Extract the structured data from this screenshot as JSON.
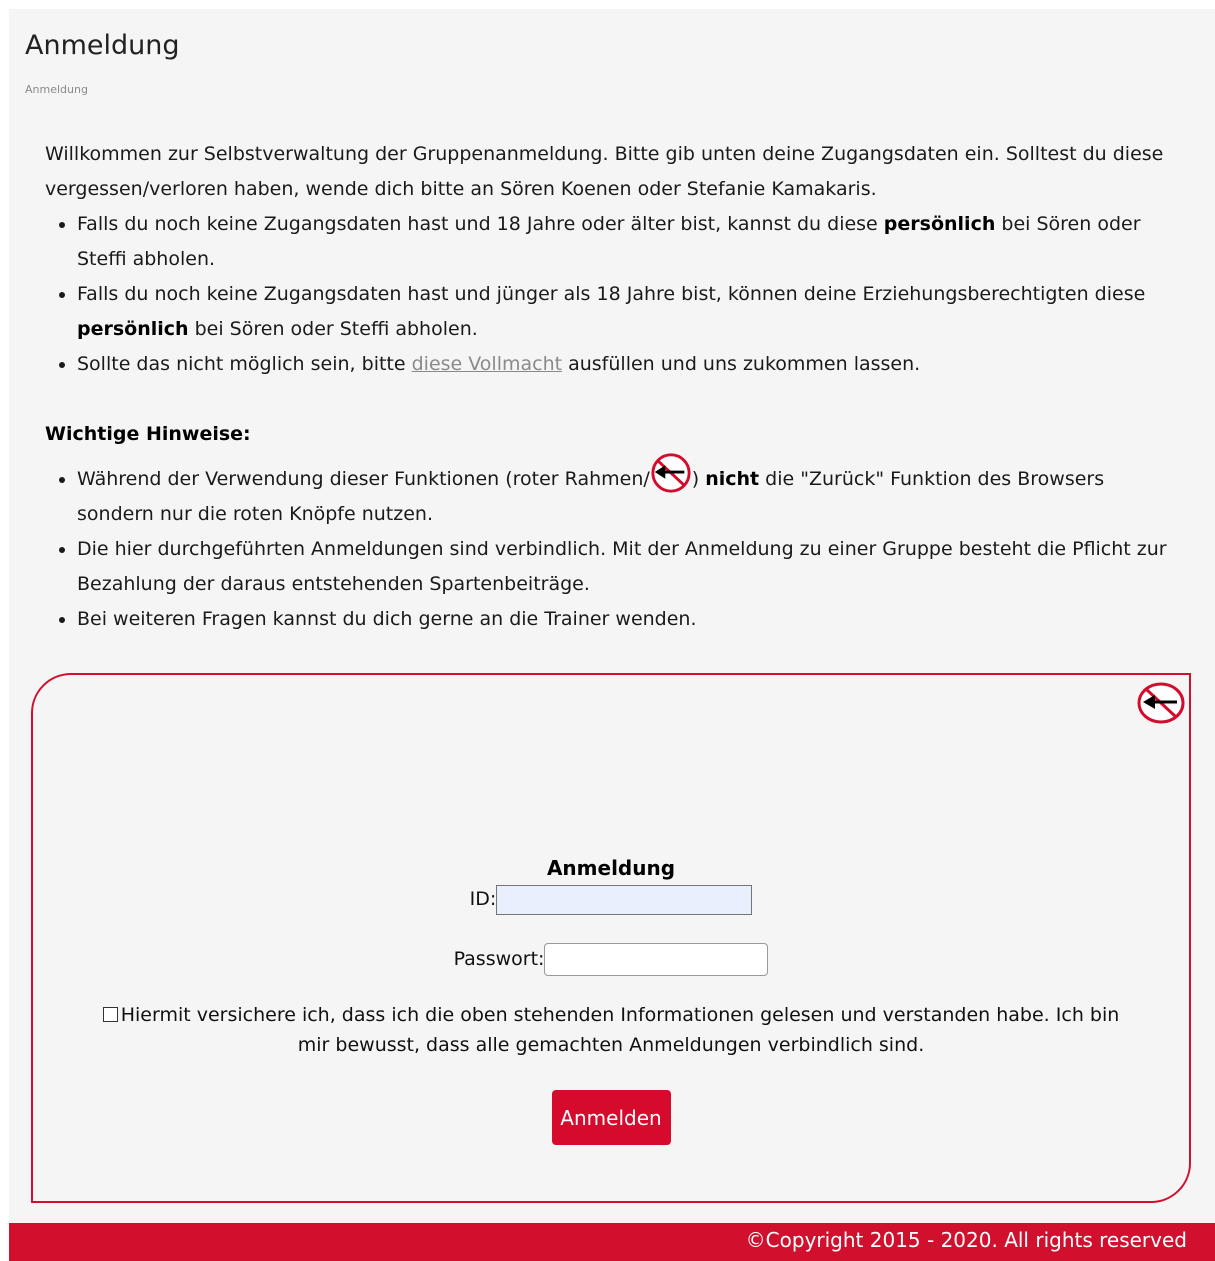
{
  "header": {
    "title": "Anmeldung",
    "breadcrumb": "Anmeldung"
  },
  "intro": {
    "welcome": "Willkommen zur Selbstverwaltung der Gruppenanmeldung. Bitte gib unten deine Zugangsdaten ein. Solltest du diese vergessen/verloren haben, wende dich bitte an Sören Koenen oder Stefanie Kamakaris.",
    "bullet1_before": "Falls du noch keine Zugangsdaten hast und 18 Jahre oder älter bist, kannst du diese ",
    "bullet1_bold": "persönlich",
    "bullet1_after": " bei Sören oder Steffi abholen.",
    "bullet2_before": "Falls du noch keine Zugangsdaten hast und jünger als 18 Jahre bist, können deine Erziehungsberechtigten diese ",
    "bullet2_bold": "persönlich",
    "bullet2_after": " bei Sören oder Steffi abholen.",
    "bullet3_before": "Sollte das nicht möglich sein, bitte ",
    "bullet3_link": "diese Vollmacht",
    "bullet3_after": " ausfüllen und uns zukommen lassen."
  },
  "notes": {
    "heading": "Wichtige Hinweise:",
    "n1_before": "Während der Verwendung dieser Funktionen (roter Rahmen/",
    "n1_bold": "nicht",
    "n1_after": " die \"Zurück\" Funktion des Browsers sondern nur die roten Knöpfe nutzen.",
    "n2": "Die hier durchgeführten Anmeldungen sind verbindlich. Mit der Anmeldung zu einer Gruppe besteht die Pflicht zur Bezahlung der daraus entstehenden Spartenbeiträge.",
    "n3": "Bei weiteren Fragen kannst du dich gerne an die Trainer wenden."
  },
  "form": {
    "title": "Anmeldung",
    "id_label": "ID:",
    "id_value": "",
    "password_label": "Passwort:",
    "password_value": "",
    "consent_text": "Hiermit versichere ich, dass ich die oben stehenden Informationen gelesen und verstanden habe. Ich bin mir bewusst, dass alle gemachten Anmeldungen verbindlich sind.",
    "consent_checked": false,
    "submit_label": "Anmelden"
  },
  "footer": {
    "copyright": "©Copyright 2015 - 2020. All rights reserved"
  },
  "icons": {
    "no_back": "no-back-icon"
  },
  "colors": {
    "accent": "#d0102d",
    "button": "#d50a2c",
    "page_bg": "#f5f5f5",
    "autofill_bg": "#e8f0fe",
    "link": "#8a8a8a"
  }
}
